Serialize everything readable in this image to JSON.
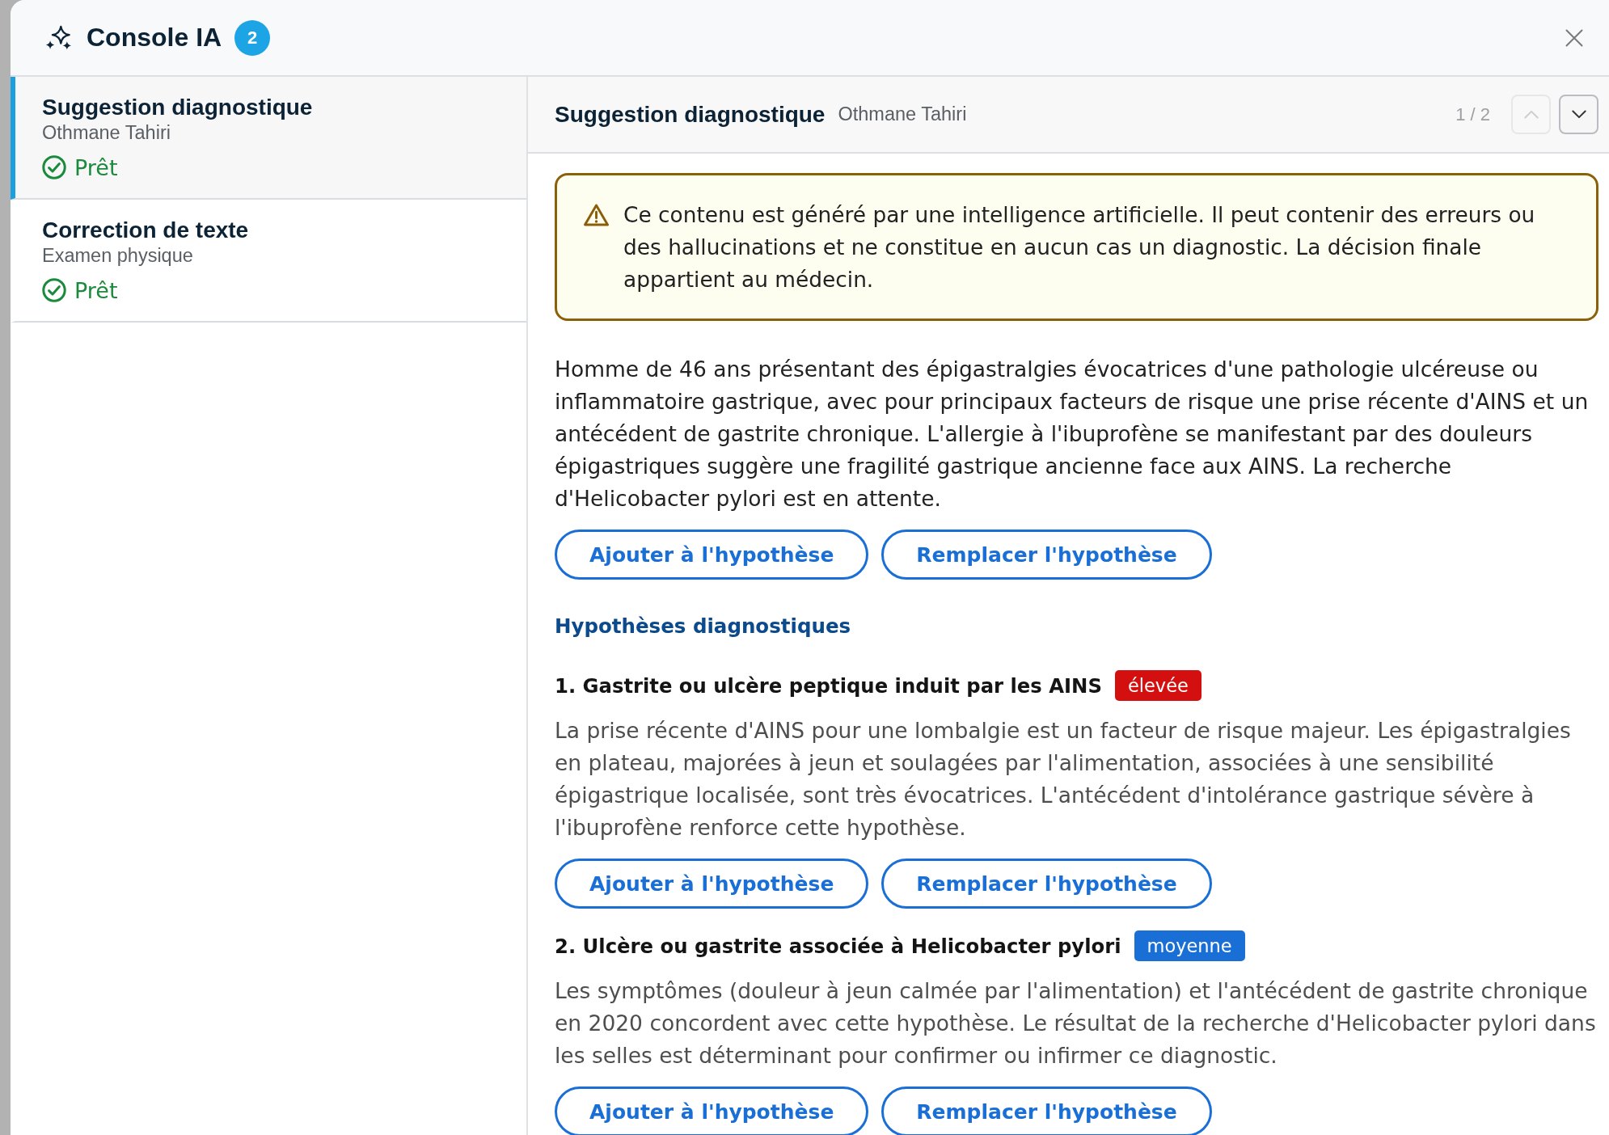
{
  "header": {
    "title": "Console IA",
    "badge": "2"
  },
  "sidebar": {
    "items": [
      {
        "title": "Suggestion diagnostique",
        "subtitle": "Othmane Tahiri",
        "status": "Prêt",
        "selected": true
      },
      {
        "title": "Correction de texte",
        "subtitle": "Examen physique",
        "status": "Prêt",
        "selected": false
      }
    ]
  },
  "detail": {
    "title": "Suggestion diagnostique",
    "subtitle": "Othmane Tahiri",
    "pager": "1 / 2",
    "nav_buttons": [
      {
        "kind": "up",
        "disabled": true
      },
      {
        "kind": "down",
        "disabled": false
      }
    ],
    "warning": "Ce contenu est généré par une intelligence artificielle. Il peut contenir des erreurs ou des hallucinations et ne constitue en aucun cas un diagnostic. La décision finale appartient au médecin.",
    "summary": "Homme de 46 ans présentant des épigastralgies évocatrices d'une pathologie ulcéreuse ou inflammatoire gastrique, avec pour principaux facteurs de risque une prise récente d'AINS et un antécédent de gastrite chronique. L'allergie à l'ibuprofène se manifestant par des douleurs épigastriques suggère une fragilité gastrique ancienne face aux AINS. La recherche d'Helicobacter pylori est en attente.",
    "summary_actions": [
      "Ajouter à l'hypothèse",
      "Remplacer l'hypothèse"
    ],
    "hypotheses_heading": "Hypothèses diagnostiques",
    "hypotheses": [
      {
        "title": "1. Gastrite ou ulcère peptique induit par les AINS",
        "likelihood": "élevée",
        "color": "#d40f0f",
        "description": "La prise récente d'AINS pour une lombalgie est un facteur de risque majeur. Les épigastralgies en plateau, majorées à jeun et soulagées par l'alimentation, associées à une sensibilité épigastrique localisée, sont très évocatrices. L'antécédent d'intolérance gastrique sévère à l'ibuprofène renforce cette hypothèse.",
        "actions": [
          "Ajouter à l'hypothèse",
          "Remplacer l'hypothèse"
        ]
      },
      {
        "title": "2. Ulcère ou gastrite associée à Helicobacter pylori",
        "likelihood": "moyenne",
        "color": "#1a6fd6",
        "description": "Les symptômes (douleur à jeun calmée par l'alimentation) et l'antécédent de gastrite chronique en 2020 concordent avec cette hypothèse. Le résultat de la recherche d'Helicobacter pylori dans les selles est déterminant pour confirmer ou infirmer ce diagnostic.",
        "actions": [
          "Ajouter à l'hypothèse",
          "Remplacer l'hypothèse"
        ]
      }
    ]
  }
}
